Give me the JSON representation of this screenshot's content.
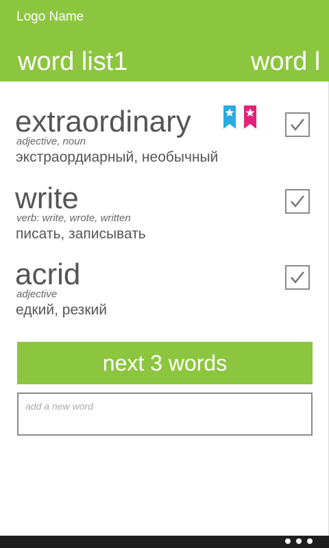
{
  "header": {
    "logo": "Logo Name",
    "pivot_current": "word  list1",
    "pivot_next": "word l"
  },
  "words": [
    {
      "term": "extraordinary",
      "pos": "adjective, noun",
      "translation": "экстраордиарный, необычный",
      "checked": true,
      "bookmarks": [
        "bookmark-star-blue-icon",
        "bookmark-star-pink-icon"
      ]
    },
    {
      "term": "write",
      "pos": "verb: write, wrote, written",
      "translation": "писать, записывать",
      "checked": true
    },
    {
      "term": "acrid",
      "pos": "adjective",
      "translation": "едкий, резкий",
      "checked": true
    }
  ],
  "actions": {
    "next_label": "next 3 words",
    "add_placeholder": "add a new word"
  },
  "colors": {
    "accent": "#8cc63f",
    "bookmark_blue": "#29abe2",
    "bookmark_pink": "#e5207a",
    "app_bar": "#1f1f1f"
  },
  "app_bar": {
    "more_icon": "ellipsis-icon"
  }
}
